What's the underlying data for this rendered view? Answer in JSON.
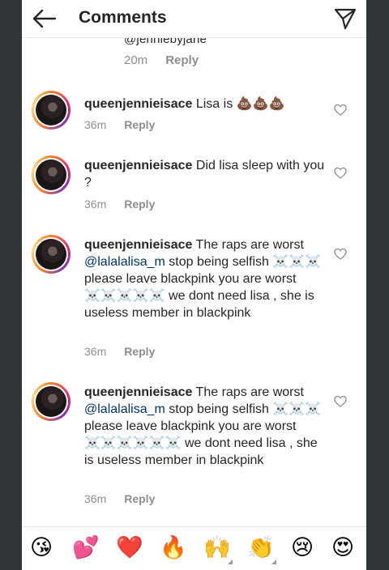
{
  "header": {
    "title": "Comments"
  },
  "prev_comment": {
    "handle": "@jenniebyjane",
    "time": "20m",
    "reply_label": "Reply"
  },
  "comments": [
    {
      "username": "queenjennieisace",
      "text": "Lisa is 💩💩💩",
      "time": "36m",
      "reply_label": "Reply"
    },
    {
      "username": "queenjennieisace",
      "text": "Did lisa sleep with you ?",
      "time": "36m",
      "reply_label": "Reply"
    },
    {
      "username": "queenjennieisace",
      "text_before": "The raps are worst",
      "mention": "@lalalalisa_m",
      "text_after": "stop being selfish ☠️☠️☠️ please leave blackpink you are worst ☠️☠️☠️☠️☠️ we dont need lisa , she is useless member in blackpink",
      "time": "36m",
      "reply_label": "Reply"
    },
    {
      "username": "queenjennieisace",
      "text_before": "The raps are worst",
      "mention": "@lalalalisa_m",
      "text_after": "stop being selfish ☠️☠️☠️ please leave blackpink you are worst ☠️☠️☠️☠️☠️☠️ we dont need lisa , she is useless member in blackpink",
      "time": "36m",
      "reply_label": "Reply"
    }
  ],
  "emoji_bar": {
    "emojis": [
      "😘",
      "💕",
      "❤️",
      "🔥",
      "🙌",
      "👏",
      "😢",
      "😍"
    ]
  },
  "icons": {
    "back": "back-arrow-icon",
    "send": "send-icon",
    "like": "heart-icon"
  },
  "colors": {
    "text": "#262626",
    "meta": "#8e8e8e",
    "mention": "#003569",
    "background_outer": "#2f3538"
  }
}
